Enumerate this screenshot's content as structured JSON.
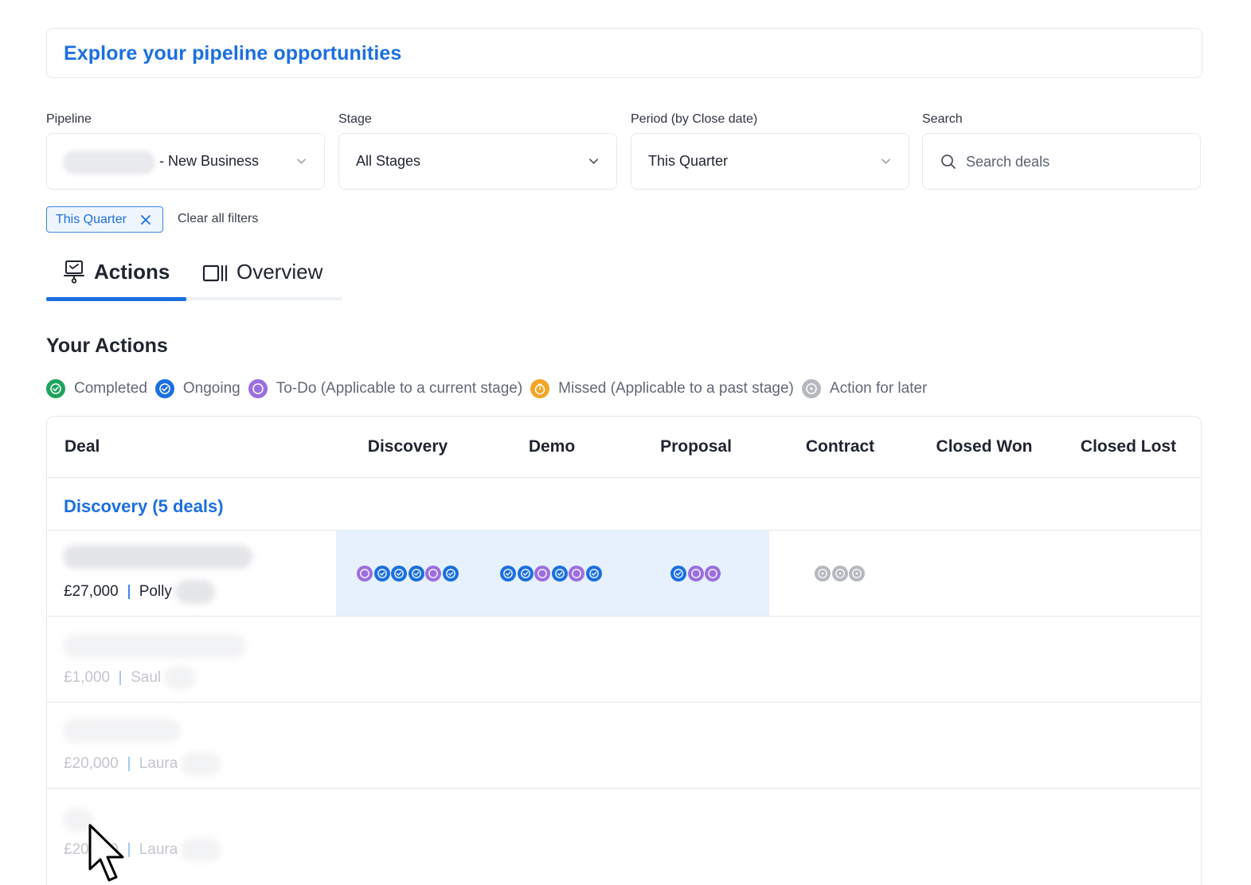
{
  "banner": {
    "title": "Explore your pipeline opportunities"
  },
  "filters": {
    "pipeline": {
      "label": "Pipeline",
      "value": "- New Business"
    },
    "stage": {
      "label": "Stage",
      "value": "All Stages"
    },
    "period": {
      "label": "Period (by Close date)",
      "value": "This Quarter"
    },
    "search": {
      "label": "Search",
      "placeholder": "Search deals"
    },
    "active_chip": "This Quarter",
    "clear_label": "Clear all filters"
  },
  "tabs": [
    {
      "label": "Actions",
      "icon": "presentation-icon",
      "active": true
    },
    {
      "label": "Overview",
      "icon": "columns-icon",
      "active": false
    }
  ],
  "section_title": "Your Actions",
  "legend": [
    {
      "label": "Completed",
      "color": "#1fa35c",
      "icon": "check-circle-icon"
    },
    {
      "label": "Ongoing",
      "color": "#1b6fe0",
      "icon": "check-circle-icon"
    },
    {
      "label": "To-Do (Applicable to a current stage)",
      "color": "#9b6ee0",
      "icon": "circle-icon"
    },
    {
      "label": "Missed (Applicable to a past stage)",
      "color": "#f2a628",
      "icon": "timer-icon"
    },
    {
      "label": "Action for later",
      "color": "#b5b8be",
      "icon": "circle-icon"
    }
  ],
  "table": {
    "headers": [
      "Deal",
      "Discovery",
      "Demo",
      "Proposal",
      "Contract",
      "Closed Won",
      "Closed Lost"
    ],
    "group_title": "Discovery (5 deals)",
    "rows": [
      {
        "amount": "£27,000",
        "owner": "Polly",
        "stages": {
          "discovery": [
            "todo",
            "ongoing",
            "ongoing",
            "ongoing",
            "todo",
            "ongoing"
          ],
          "demo": [
            "ongoing",
            "ongoing",
            "todo",
            "ongoing",
            "todo",
            "ongoing"
          ],
          "proposal": [
            "ongoing",
            "todo",
            "todo"
          ],
          "contract": [
            "later",
            "later",
            "later"
          ]
        }
      },
      {
        "amount": "£1,000",
        "owner": "Saul"
      },
      {
        "amount": "£20,000",
        "owner": "Laura"
      },
      {
        "amount": "£20,000",
        "owner": "Laura"
      }
    ]
  },
  "colors": {
    "accent": "#1b6fe0",
    "todo": "#9b6ee0",
    "ongoing": "#1b6fe0",
    "later": "#b5b8be",
    "highlight": "#e6f1fd"
  }
}
